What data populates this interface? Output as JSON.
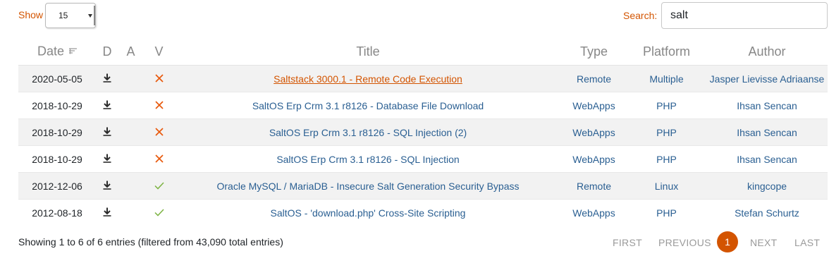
{
  "controls": {
    "show_label": "Show",
    "length_value": "15",
    "search_label": "Search:",
    "search_value": "salt"
  },
  "table": {
    "headers": {
      "date": "Date",
      "d": "D",
      "a": "A",
      "v": "V",
      "title": "Title",
      "type": "Type",
      "platform": "Platform",
      "author": "Author"
    },
    "rows": [
      {
        "date": "2020-05-05",
        "verified": false,
        "title": "Saltstack 3000.1 - Remote Code Execution",
        "type": "Remote",
        "platform": "Multiple",
        "author": "Jasper Lievisse Adriaanse"
      },
      {
        "date": "2018-10-29",
        "verified": false,
        "title": "SaltOS Erp Crm 3.1 r8126 - Database File Download",
        "type": "WebApps",
        "platform": "PHP",
        "author": "Ihsan Sencan"
      },
      {
        "date": "2018-10-29",
        "verified": false,
        "title": "SaltOS Erp Crm 3.1 r8126 - SQL Injection (2)",
        "type": "WebApps",
        "platform": "PHP",
        "author": "Ihsan Sencan"
      },
      {
        "date": "2018-10-29",
        "verified": false,
        "title": "SaltOS Erp Crm 3.1 r8126 - SQL Injection",
        "type": "WebApps",
        "platform": "PHP",
        "author": "Ihsan Sencan"
      },
      {
        "date": "2012-12-06",
        "verified": true,
        "title": "Oracle MySQL / MariaDB - Insecure Salt Generation Security Bypass",
        "type": "Remote",
        "platform": "Linux",
        "author": "kingcope"
      },
      {
        "date": "2012-08-18",
        "verified": true,
        "title": "SaltOS - 'download.php' Cross-Site Scripting",
        "type": "WebApps",
        "platform": "PHP",
        "author": "Stefan Schurtz"
      }
    ]
  },
  "footer": {
    "info": "Showing 1 to 6 of 6 entries (filtered from 43,090 total entries)",
    "first": "FIRST",
    "previous": "PREVIOUS",
    "current_page": "1",
    "next": "NEXT",
    "last": "LAST"
  },
  "colors": {
    "accent": "#d35400",
    "link": "#2a5f92",
    "verified": "#7cb342",
    "unverified": "#e8590c",
    "striped_row": "#f2f2f2"
  },
  "icons": {
    "download": "download-icon",
    "verified": "check-icon",
    "unverified": "cross-icon",
    "sort": "sort-icon"
  }
}
